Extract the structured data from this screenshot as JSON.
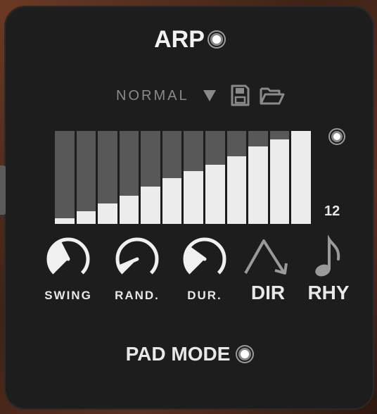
{
  "header": {
    "title": "ARP"
  },
  "preset": {
    "name": "NORMAL"
  },
  "sequencer": {
    "step_count": "12",
    "levels": [
      0.06,
      0.14,
      0.22,
      0.3,
      0.4,
      0.49,
      0.57,
      0.64,
      0.73,
      0.83,
      0.91,
      1.0
    ]
  },
  "controls": {
    "swing": {
      "label": "SWING",
      "value": 0.4
    },
    "random": {
      "label": "RAND.",
      "value": 0.08
    },
    "duration": {
      "label": "DUR.",
      "value": 0.3
    },
    "direction": {
      "label": "DIR"
    },
    "rhythm": {
      "label": "RHY"
    }
  },
  "pad_mode": {
    "label": "PAD MODE"
  },
  "colors": {
    "panel": "#1d1d1d",
    "bar_bg": "#585858",
    "bar_fill": "#ececec",
    "label": "#e8e8e8",
    "dim": "#8a8a8a"
  }
}
